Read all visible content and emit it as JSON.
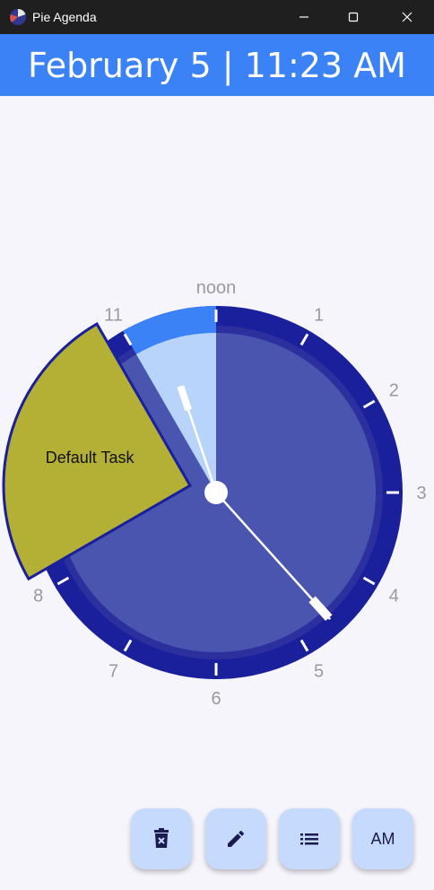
{
  "window": {
    "title": "Pie Agenda",
    "controls": [
      "minimize",
      "maximize",
      "close"
    ]
  },
  "header": {
    "date": "February 5",
    "separator": "|",
    "time": "11:23 AM",
    "text": "February 5 | 11:23 AM"
  },
  "clock": {
    "hour_labels": [
      "noon",
      "1",
      "2",
      "3",
      "4",
      "5",
      "6",
      "7",
      "8",
      "11"
    ],
    "hand_time": "11:23",
    "current_hour_highlight": "11 to 12",
    "task": {
      "label": "Default Task",
      "start": "8:00",
      "end": "11:00",
      "color": "#b3b035"
    },
    "colors": {
      "face": "#4a55b0",
      "outer_ring": "#1a1f9c",
      "inner_ring": "#2b309e",
      "highlight_light": "#b8d4fa",
      "highlight_blue": "#3b82f6",
      "label": "#9a9a9a"
    }
  },
  "actions": {
    "delete_icon": "delete-icon",
    "edit_icon": "edit-icon",
    "list_icon": "list-icon",
    "am_pm_label": "AM"
  }
}
